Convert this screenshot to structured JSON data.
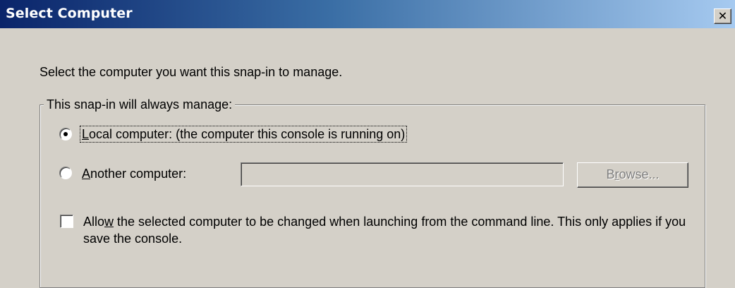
{
  "window": {
    "title": "Select Computer",
    "close_glyph": "✕"
  },
  "intro_text": "Select the computer you want this snap-in to manage.",
  "group": {
    "legend": "This snap-in will always manage:",
    "local_option": {
      "mnemonic": "L",
      "label_rest": "ocal computer:  (the computer this console is running on)",
      "selected": true
    },
    "another_option": {
      "mnemonic": "A",
      "label_rest": "nother computer:",
      "selected": false
    },
    "computer_name_value": "",
    "browse_button": {
      "label_pre": "B",
      "mnemonic": "r",
      "label_post": "owse...",
      "enabled": false
    },
    "allow_change_checkbox": {
      "label_pre": "Allo",
      "mnemonic": "w",
      "label_post": " the selected computer to be changed when launching from the command line.  This only applies if you save the console.",
      "checked": false
    }
  }
}
